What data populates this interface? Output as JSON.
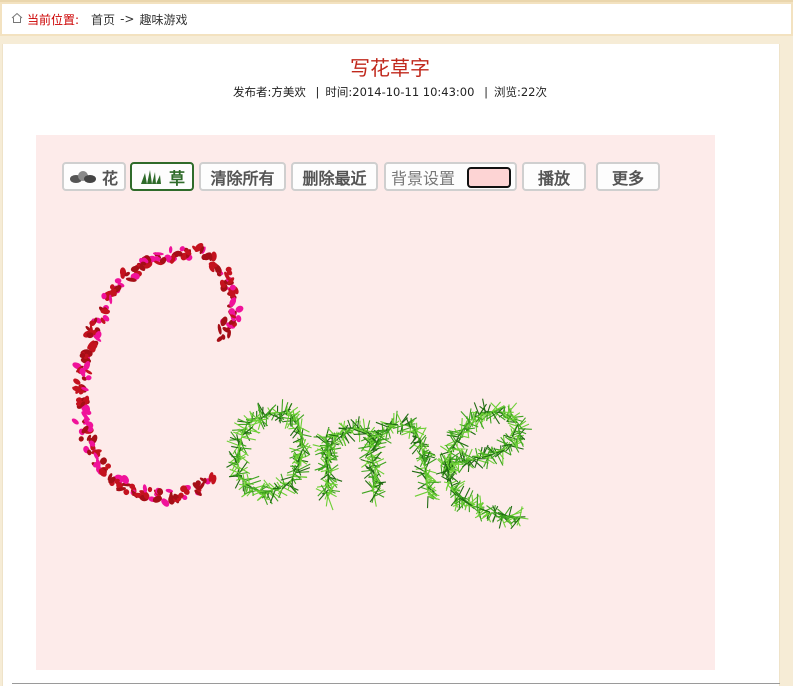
{
  "breadcrumb": {
    "label": "当前位置:",
    "home": "首页",
    "separator": "->",
    "current": "趣味游戏"
  },
  "article": {
    "title": "写花草字",
    "publisher_label": "发布者:",
    "publisher": "方美欢",
    "time_label": "时间:",
    "time": "2014-10-11 10:43:00",
    "views_label": "浏览:",
    "views": "22次"
  },
  "toolbar": {
    "flower": "花",
    "grass": "草",
    "clear_all": "清除所有",
    "delete_last": "删除最近",
    "background_setting": "背景设置",
    "play": "播放",
    "more": "更多"
  },
  "colors": {
    "title": "#c0281c",
    "canvas_bg": "#fdebea",
    "swatch": "#fdd4d4",
    "flower_red": "#c4121e",
    "flower_pink": "#f0129a",
    "grass_green": "#3ea31f",
    "active_border": "#2f6b2a"
  },
  "icons": {
    "home": "home-icon",
    "flower": "flower-icon",
    "grass": "grass-icon"
  }
}
